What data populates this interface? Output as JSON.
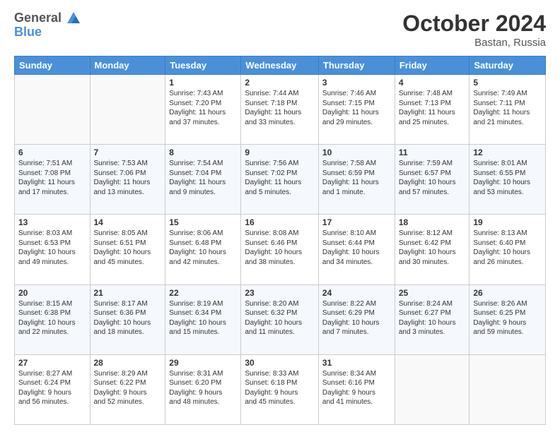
{
  "header": {
    "logo_line1": "General",
    "logo_line2": "Blue",
    "month": "October 2024",
    "location": "Bastan, Russia"
  },
  "weekdays": [
    "Sunday",
    "Monday",
    "Tuesday",
    "Wednesday",
    "Thursday",
    "Friday",
    "Saturday"
  ],
  "weeks": [
    [
      {
        "day": "",
        "info": ""
      },
      {
        "day": "",
        "info": ""
      },
      {
        "day": "1",
        "info": "Sunrise: 7:43 AM\nSunset: 7:20 PM\nDaylight: 11 hours\nand 37 minutes."
      },
      {
        "day": "2",
        "info": "Sunrise: 7:44 AM\nSunset: 7:18 PM\nDaylight: 11 hours\nand 33 minutes."
      },
      {
        "day": "3",
        "info": "Sunrise: 7:46 AM\nSunset: 7:15 PM\nDaylight: 11 hours\nand 29 minutes."
      },
      {
        "day": "4",
        "info": "Sunrise: 7:48 AM\nSunset: 7:13 PM\nDaylight: 11 hours\nand 25 minutes."
      },
      {
        "day": "5",
        "info": "Sunrise: 7:49 AM\nSunset: 7:11 PM\nDaylight: 11 hours\nand 21 minutes."
      }
    ],
    [
      {
        "day": "6",
        "info": "Sunrise: 7:51 AM\nSunset: 7:08 PM\nDaylight: 11 hours\nand 17 minutes."
      },
      {
        "day": "7",
        "info": "Sunrise: 7:53 AM\nSunset: 7:06 PM\nDaylight: 11 hours\nand 13 minutes."
      },
      {
        "day": "8",
        "info": "Sunrise: 7:54 AM\nSunset: 7:04 PM\nDaylight: 11 hours\nand 9 minutes."
      },
      {
        "day": "9",
        "info": "Sunrise: 7:56 AM\nSunset: 7:02 PM\nDaylight: 11 hours\nand 5 minutes."
      },
      {
        "day": "10",
        "info": "Sunrise: 7:58 AM\nSunset: 6:59 PM\nDaylight: 11 hours\nand 1 minute."
      },
      {
        "day": "11",
        "info": "Sunrise: 7:59 AM\nSunset: 6:57 PM\nDaylight: 10 hours\nand 57 minutes."
      },
      {
        "day": "12",
        "info": "Sunrise: 8:01 AM\nSunset: 6:55 PM\nDaylight: 10 hours\nand 53 minutes."
      }
    ],
    [
      {
        "day": "13",
        "info": "Sunrise: 8:03 AM\nSunset: 6:53 PM\nDaylight: 10 hours\nand 49 minutes."
      },
      {
        "day": "14",
        "info": "Sunrise: 8:05 AM\nSunset: 6:51 PM\nDaylight: 10 hours\nand 45 minutes."
      },
      {
        "day": "15",
        "info": "Sunrise: 8:06 AM\nSunset: 6:48 PM\nDaylight: 10 hours\nand 42 minutes."
      },
      {
        "day": "16",
        "info": "Sunrise: 8:08 AM\nSunset: 6:46 PM\nDaylight: 10 hours\nand 38 minutes."
      },
      {
        "day": "17",
        "info": "Sunrise: 8:10 AM\nSunset: 6:44 PM\nDaylight: 10 hours\nand 34 minutes."
      },
      {
        "day": "18",
        "info": "Sunrise: 8:12 AM\nSunset: 6:42 PM\nDaylight: 10 hours\nand 30 minutes."
      },
      {
        "day": "19",
        "info": "Sunrise: 8:13 AM\nSunset: 6:40 PM\nDaylight: 10 hours\nand 26 minutes."
      }
    ],
    [
      {
        "day": "20",
        "info": "Sunrise: 8:15 AM\nSunset: 6:38 PM\nDaylight: 10 hours\nand 22 minutes."
      },
      {
        "day": "21",
        "info": "Sunrise: 8:17 AM\nSunset: 6:36 PM\nDaylight: 10 hours\nand 18 minutes."
      },
      {
        "day": "22",
        "info": "Sunrise: 8:19 AM\nSunset: 6:34 PM\nDaylight: 10 hours\nand 15 minutes."
      },
      {
        "day": "23",
        "info": "Sunrise: 8:20 AM\nSunset: 6:32 PM\nDaylight: 10 hours\nand 11 minutes."
      },
      {
        "day": "24",
        "info": "Sunrise: 8:22 AM\nSunset: 6:29 PM\nDaylight: 10 hours\nand 7 minutes."
      },
      {
        "day": "25",
        "info": "Sunrise: 8:24 AM\nSunset: 6:27 PM\nDaylight: 10 hours\nand 3 minutes."
      },
      {
        "day": "26",
        "info": "Sunrise: 8:26 AM\nSunset: 6:25 PM\nDaylight: 9 hours\nand 59 minutes."
      }
    ],
    [
      {
        "day": "27",
        "info": "Sunrise: 8:27 AM\nSunset: 6:24 PM\nDaylight: 9 hours\nand 56 minutes."
      },
      {
        "day": "28",
        "info": "Sunrise: 8:29 AM\nSunset: 6:22 PM\nDaylight: 9 hours\nand 52 minutes."
      },
      {
        "day": "29",
        "info": "Sunrise: 8:31 AM\nSunset: 6:20 PM\nDaylight: 9 hours\nand 48 minutes."
      },
      {
        "day": "30",
        "info": "Sunrise: 8:33 AM\nSunset: 6:18 PM\nDaylight: 9 hours\nand 45 minutes."
      },
      {
        "day": "31",
        "info": "Sunrise: 8:34 AM\nSunset: 6:16 PM\nDaylight: 9 hours\nand 41 minutes."
      },
      {
        "day": "",
        "info": ""
      },
      {
        "day": "",
        "info": ""
      }
    ]
  ]
}
